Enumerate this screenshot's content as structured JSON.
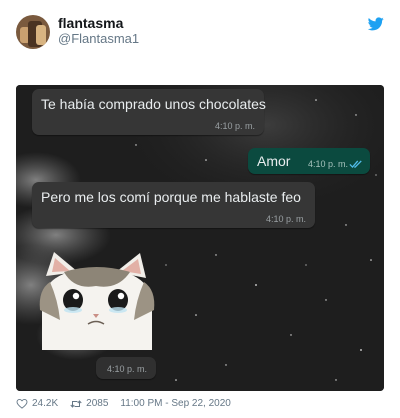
{
  "user": {
    "name": "flantasma",
    "handle": "@Flantasma1"
  },
  "icons": {
    "brand": "twitter-bird-icon",
    "like": "heart-icon",
    "retweet": "retweet-icon",
    "read_receipt": "double-check-icon",
    "avatar": "avatar-photo"
  },
  "colors": {
    "twitter_blue": "#1da1f2",
    "chat_incoming": "#363636",
    "chat_outgoing": "#0b4a3f",
    "read_check": "#53bdeb"
  },
  "chat": {
    "messages": [
      {
        "text": "Te había comprado unos chocolates",
        "time": "4:10 p. m.",
        "direction": "incoming"
      },
      {
        "text": "Amor",
        "time": "4:10 p. m.",
        "direction": "outgoing"
      },
      {
        "text": "Pero me los comí porque me hablaste feo",
        "time": "4:10 p. m.",
        "direction": "incoming"
      }
    ],
    "sticker": {
      "description": "sad-cat-sticker",
      "time": "4:10 p. m."
    }
  },
  "footer": {
    "likes": "24.2K",
    "retweets": "2085",
    "timestamp": "11:00 PM - Sep 22, 2020"
  }
}
